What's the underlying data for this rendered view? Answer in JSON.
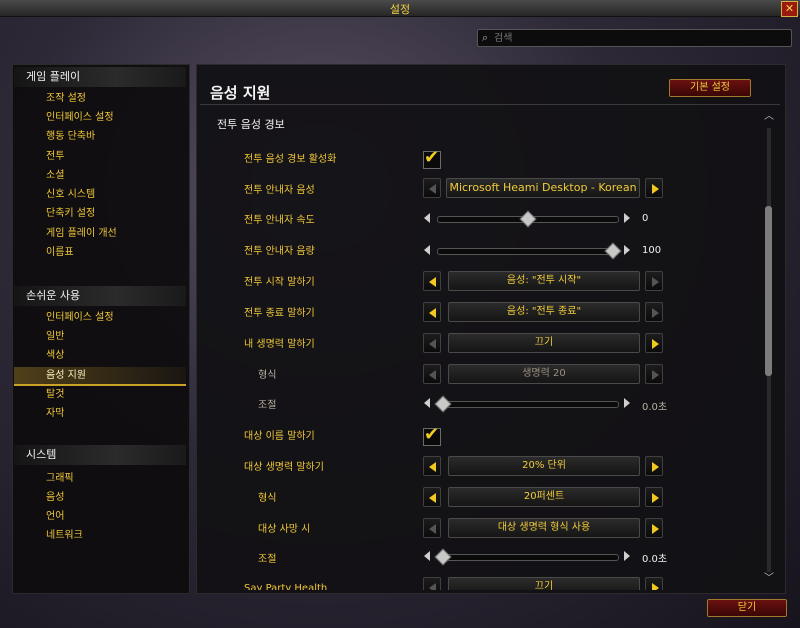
{
  "window": {
    "title": "설정"
  },
  "search": {
    "placeholder": "검색"
  },
  "sidebar": {
    "game_header": "게임 플레이",
    "game_items": [
      "조작 설정",
      "인터페이스 설정",
      "행동 단축바",
      "전투",
      "소셜",
      "신호 시스템",
      "단축키 설정",
      "게임 플레이 개선",
      "이름표"
    ],
    "access_header": "손쉬운 사용",
    "access_items": [
      "인터페이스 설정",
      "일반",
      "색상",
      "음성 지원",
      "탈것",
      "자막"
    ],
    "active_item": "음성 지원",
    "system_header": "시스템",
    "system_items": [
      "그래픽",
      "음성",
      "언어",
      "네트워크"
    ]
  },
  "main": {
    "title": "음성 지원",
    "default_button": "기본 설정",
    "section": "전투 음성 경보",
    "rows": {
      "r1": {
        "label": "전투 음성 경보 활성화",
        "checked": true
      },
      "r2": {
        "label": "전투 안내자 음성",
        "value": "Microsoft Heami Desktop - Korean"
      },
      "r3": {
        "label": "전투 안내자 속도",
        "value": "0",
        "level": 0.5
      },
      "r4": {
        "label": "전투 안내자 음량",
        "value": "100",
        "level": 1.0
      },
      "r5": {
        "label": "전투 시작 말하기",
        "value": "음성: \"전투 시작\""
      },
      "r6": {
        "label": "전투 종료 말하기",
        "value": "음성: \"전투 종료\""
      },
      "r7": {
        "label": "내 생명력 말하기",
        "value": "끄기"
      },
      "r8": {
        "label": "형식",
        "value": "생명력 20"
      },
      "r9": {
        "label": "조절",
        "value": "0.0초",
        "level": 0.0
      },
      "r10": {
        "label": "대상 이름 말하기",
        "checked": true
      },
      "r11": {
        "label": "대상 생명력 말하기",
        "value": "20% 단위"
      },
      "r12": {
        "label": "형식",
        "value": "20퍼센트"
      },
      "r13": {
        "label": "대상 사망 시",
        "value": "대상 생명력 형식 사용"
      },
      "r14": {
        "label": "조절",
        "value": "0.0초",
        "level": 0.0
      },
      "r15": {
        "label": "Say Party Health",
        "value": "끄기"
      }
    }
  },
  "footer": {
    "close_button": "닫기"
  }
}
